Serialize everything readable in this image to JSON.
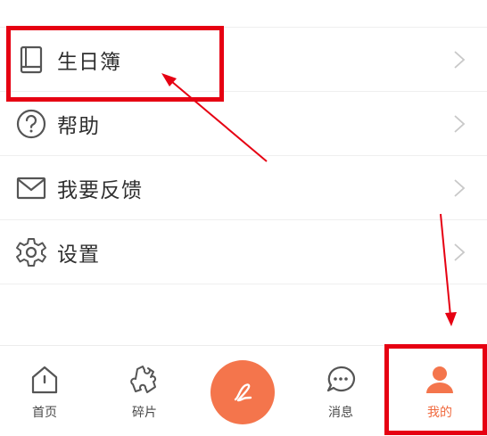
{
  "menu": {
    "items": [
      {
        "label": "生日簿",
        "icon": "book-icon"
      },
      {
        "label": "帮助",
        "icon": "help-icon"
      },
      {
        "label": "我要反馈",
        "icon": "mail-icon"
      },
      {
        "label": "设置",
        "icon": "gear-icon"
      }
    ]
  },
  "tabbar": {
    "tabs": [
      {
        "label": "首页",
        "icon": "home-icon"
      },
      {
        "label": "碎片",
        "icon": "puzzle-icon"
      },
      {
        "label": "消息",
        "icon": "message-icon"
      },
      {
        "label": "我的",
        "icon": "user-icon",
        "active": true
      }
    ],
    "fab_icon": "write-icon"
  },
  "colors": {
    "accent": "#f4754c",
    "highlight": "#e60012",
    "text": "#2f2f2f"
  }
}
